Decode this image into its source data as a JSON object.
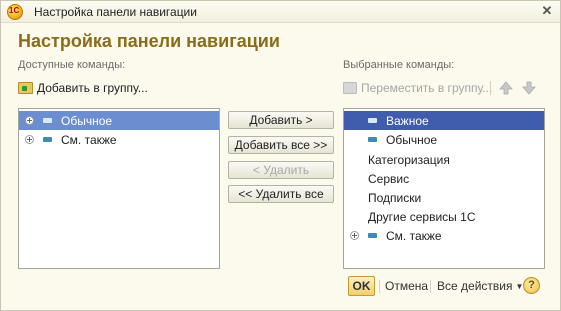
{
  "window": {
    "title": "Настройка панели навигации",
    "icon_text": "1С",
    "close_glyph": "✕"
  },
  "form_title": "Настройка панели навигации",
  "available": {
    "label": "Доступные команды:",
    "add_to_group": "Добавить в группу...",
    "items": [
      {
        "label": "Обычное",
        "selected": true,
        "expandable": true,
        "icon": "command-icon"
      },
      {
        "label": "См. также",
        "selected": false,
        "expandable": true,
        "icon": "command-icon"
      }
    ]
  },
  "selected": {
    "label": "Выбранные команды:",
    "move_to_group": "Переместить в группу...",
    "items": [
      {
        "label": "Важное",
        "focused": true,
        "expandable": false,
        "icon": "command-icon"
      },
      {
        "label": "Обычное",
        "expandable": false,
        "icon": "command-icon"
      },
      {
        "label": "Категоризация"
      },
      {
        "label": "Сервис"
      },
      {
        "label": "Подписки"
      },
      {
        "label": "Другие сервисы 1С"
      },
      {
        "label": "См. также",
        "expandable": true,
        "icon": "command-icon"
      }
    ]
  },
  "buttons": {
    "add": "Добавить >",
    "add_all": "Добавить все >>",
    "remove": "< Удалить",
    "remove_all": "<< Удалить все"
  },
  "footer": {
    "ok": "OK",
    "cancel": "Отмена",
    "all_actions": "Все действия",
    "help": "?"
  },
  "colors": {
    "title_accent": "#8a6d1c",
    "selection": "#6b8ed1",
    "focus_selection": "#3f5cad",
    "ok_button": "#f2cf6b"
  }
}
